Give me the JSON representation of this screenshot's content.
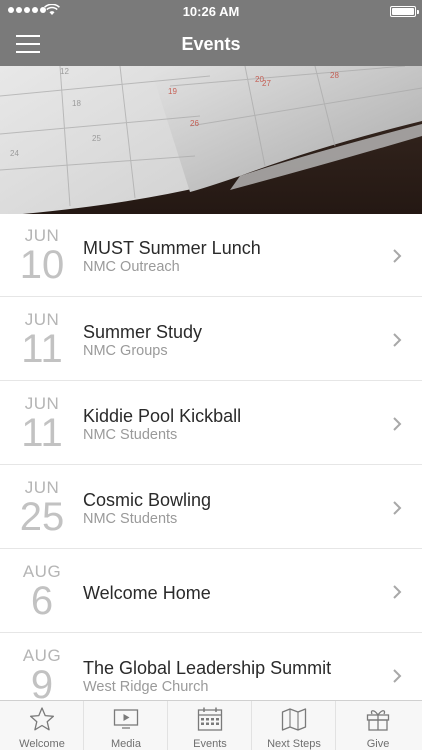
{
  "status_bar": {
    "time": "10:26 AM"
  },
  "header": {
    "title": "Events"
  },
  "events": [
    {
      "month": "JUN",
      "day": "10",
      "title": "MUST Summer Lunch",
      "subtitle": "NMC Outreach"
    },
    {
      "month": "JUN",
      "day": "11",
      "title": "Summer Study",
      "subtitle": "NMC Groups"
    },
    {
      "month": "JUN",
      "day": "11",
      "title": "Kiddie Pool Kickball",
      "subtitle": "NMC Students"
    },
    {
      "month": "JUN",
      "day": "25",
      "title": "Cosmic Bowling",
      "subtitle": "NMC Students"
    },
    {
      "month": "AUG",
      "day": "6",
      "title": "Welcome Home",
      "subtitle": ""
    },
    {
      "month": "AUG",
      "day": "9",
      "title": "The Global Leadership Summit",
      "subtitle": "West Ridge Church"
    }
  ],
  "tabs": [
    {
      "label": "Welcome",
      "icon": "star-icon"
    },
    {
      "label": "Media",
      "icon": "play-icon"
    },
    {
      "label": "Events",
      "icon": "calendar-icon"
    },
    {
      "label": "Next Steps",
      "icon": "map-icon"
    },
    {
      "label": "Give",
      "icon": "gift-icon"
    }
  ],
  "colors": {
    "bar": "#7a7a7a",
    "date": "#b5b5b5",
    "title": "#2a2a2a",
    "subtitle": "#9a9a9a"
  }
}
